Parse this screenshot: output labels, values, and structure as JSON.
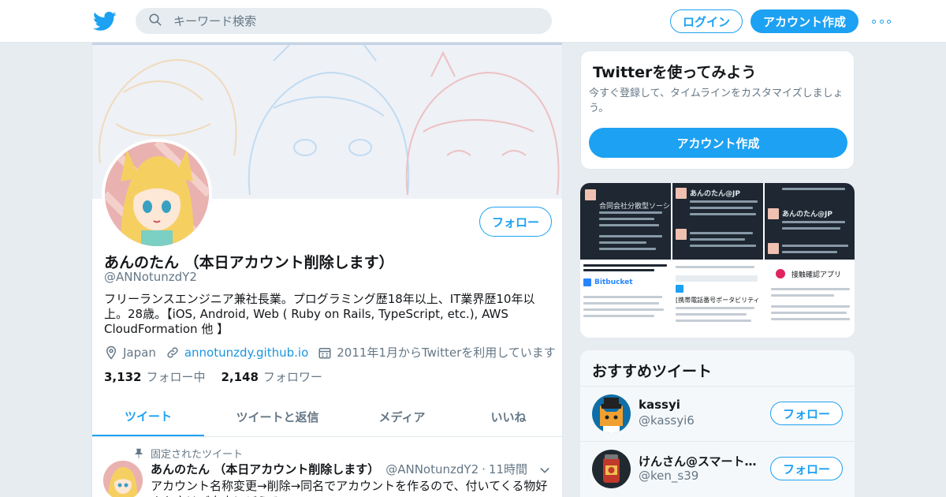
{
  "header": {
    "search_placeholder": "キーワード検索",
    "login_label": "ログイン",
    "signup_label": "アカウント作成"
  },
  "profile": {
    "name": "あんのたん （本日アカウント削除します）",
    "handle": "@ANNotunzdY2",
    "bio": "フリーランスエンジニア兼社長業。プログラミング歴18年以上、IT業界歴10年以上。28歳。【iOS, Android, Web ( Ruby on Rails, TypeScript, etc.), AWS CloudFormation 他 】",
    "location": "Japan",
    "website": "annotunzdy.github.io",
    "joined": "2011年1月からTwitterを利用しています",
    "following_count": "3,132",
    "following_label": "フォロー中",
    "followers_count": "2,148",
    "followers_label": "フォロワー",
    "follow_label": "フォロー"
  },
  "tabs": [
    {
      "label": "ツイート"
    },
    {
      "label": "ツイートと返信"
    },
    {
      "label": "メディア"
    },
    {
      "label": "いいね"
    }
  ],
  "pinned_tweet": {
    "pinned_label": "固定されたツイート",
    "author_name": "あんのたん （本日アカウント削除します）",
    "author_handle": "@ANNotunzdY2",
    "time": "11時間",
    "text": "アカウント名称変更→削除→同名でアカウントを作るので、付いてくる物好きな方はご自由にどうぞ"
  },
  "signup_card": {
    "title": "Twitterを使ってみよう",
    "description": "今すぐ登録して、タイムラインをカスタマイズしましょう。",
    "button_label": "アカウント作成"
  },
  "media_thumbs": [
    {
      "caption": "合同会社分散型ソーシャル"
    },
    {
      "caption": "あんのたん@JP"
    },
    {
      "caption": "あんのたん@JP"
    },
    {
      "caption": "Bitbucket"
    },
    {
      "caption": "[携帯電話番号ポータビリティ（MNP）]"
    },
    {
      "caption": "接触確認アプリ"
    }
  ],
  "recommended": {
    "title": "おすすめツイート",
    "users": [
      {
        "name": "kassyi",
        "handle": "@kassyi6",
        "follow_label": "フォロー"
      },
      {
        "name": "けんさん@スマート…",
        "handle": "@ken_s39",
        "follow_label": "フォロー"
      }
    ]
  },
  "colors": {
    "accent": "#1da1f2",
    "background": "#e6ecf0",
    "secondary_text": "#657786"
  }
}
